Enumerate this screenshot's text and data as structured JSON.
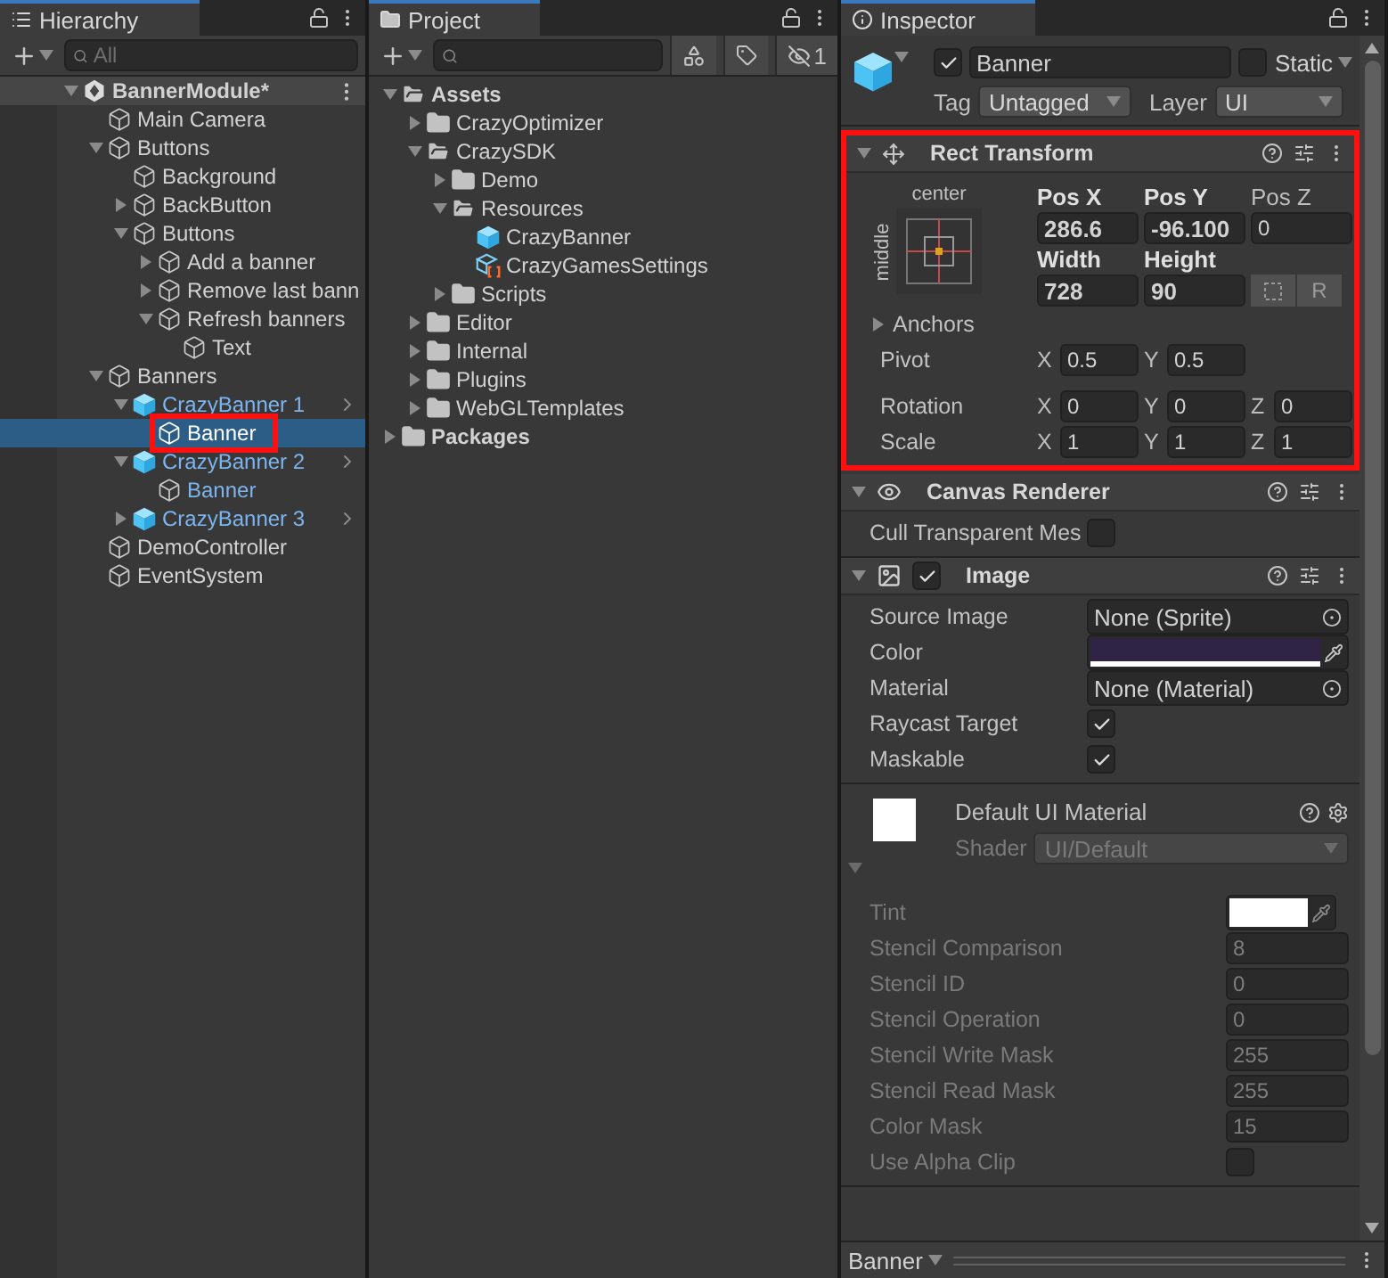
{
  "hierarchy": {
    "tab": "Hierarchy",
    "search": {
      "placeholder": "All"
    },
    "tree": [
      {
        "kind": "scene",
        "label": "BannerModule*",
        "expanded": true,
        "selected": false,
        "children": [
          {
            "kind": "object",
            "label": "Main Camera",
            "selected": false
          },
          {
            "kind": "object",
            "label": "Buttons",
            "expanded": true,
            "selected": false,
            "children": [
              {
                "kind": "object",
                "label": "Background",
                "selected": false
              },
              {
                "kind": "object",
                "label": "BackButton",
                "expanded": false,
                "selected": false
              },
              {
                "kind": "object",
                "label": "Buttons",
                "expanded": true,
                "selected": false,
                "children": [
                  {
                    "kind": "object",
                    "label": "Add a banner",
                    "expanded": false,
                    "selected": false
                  },
                  {
                    "kind": "object",
                    "label": "Remove last bann",
                    "expanded": false,
                    "selected": false
                  },
                  {
                    "kind": "object",
                    "label": "Refresh banners",
                    "expanded": true,
                    "selected": false,
                    "children": [
                      {
                        "kind": "object",
                        "label": "Text",
                        "selected": false
                      }
                    ]
                  }
                ]
              }
            ]
          },
          {
            "kind": "object",
            "label": "Banners",
            "expanded": true,
            "selected": false,
            "children": [
              {
                "kind": "prefab",
                "label": "CrazyBanner 1",
                "expanded": true,
                "selected": false,
                "children": [
                  {
                    "kind": "prefab_child",
                    "label": "Banner",
                    "selected": true,
                    "highlighted": true
                  }
                ]
              },
              {
                "kind": "prefab",
                "label": "CrazyBanner 2",
                "expanded": true,
                "selected": false,
                "children": [
                  {
                    "kind": "prefab_child",
                    "label": "Banner",
                    "selected": false
                  }
                ]
              },
              {
                "kind": "prefab",
                "label": "CrazyBanner 3",
                "expanded": false,
                "selected": false
              }
            ]
          },
          {
            "kind": "object",
            "label": "DemoController",
            "selected": false
          },
          {
            "kind": "object",
            "label": "EventSystem",
            "selected": false
          }
        ]
      }
    ]
  },
  "project": {
    "tab": "Project",
    "hidden_count": "1",
    "tree": [
      {
        "kind": "folder",
        "label": "Assets",
        "expanded": true,
        "selected": false,
        "children": [
          {
            "kind": "folder",
            "label": "CrazyOptimizer",
            "expanded": false,
            "selected": false
          },
          {
            "kind": "folder",
            "label": "CrazySDK",
            "expanded": true,
            "selected": false,
            "children": [
              {
                "kind": "folder",
                "label": "Demo",
                "expanded": false,
                "selected": false
              },
              {
                "kind": "folder",
                "label": "Resources",
                "expanded": true,
                "selected": false,
                "children": [
                  {
                    "kind": "prefab_asset",
                    "label": "CrazyBanner",
                    "selected": false
                  },
                  {
                    "kind": "settings_asset",
                    "label": "CrazyGamesSettings",
                    "selected": false
                  }
                ]
              },
              {
                "kind": "folder",
                "label": "Scripts",
                "expanded": false,
                "selected": false
              }
            ]
          },
          {
            "kind": "folder",
            "label": "Editor",
            "expanded": false,
            "selected": false
          },
          {
            "kind": "folder",
            "label": "Internal",
            "expanded": false,
            "selected": false
          },
          {
            "kind": "folder",
            "label": "Plugins",
            "expanded": false,
            "selected": false
          },
          {
            "kind": "folder",
            "label": "WebGLTemplates",
            "expanded": false,
            "selected": false
          }
        ]
      },
      {
        "kind": "folder",
        "label": "Packages",
        "expanded": false,
        "selected": false
      }
    ]
  },
  "inspector": {
    "tab": "Inspector",
    "object": {
      "active": true,
      "name": "Banner",
      "static": false,
      "static_label": "Static",
      "tag_label": "Tag",
      "tag": "Untagged",
      "layer_label": "Layer",
      "layer": "UI"
    },
    "components": [
      {
        "kind": "rect_transform",
        "title": "Rect Transform",
        "expanded": true,
        "highlighted": true,
        "anchor_h": "center",
        "anchor_v": "middle",
        "fields": [
          {
            "label": "Pos X",
            "value": "286.6",
            "overridden": true
          },
          {
            "label": "Pos Y",
            "value": "-96.100",
            "overridden": true
          },
          {
            "label": "Pos Z",
            "value": "0",
            "overridden": false
          },
          {
            "label": "Width",
            "value": "728",
            "overridden": true
          },
          {
            "label": "Height",
            "value": "90",
            "overridden": true
          }
        ],
        "raw_edit": "R",
        "anchors": {
          "label": "Anchors",
          "expanded": false
        },
        "vectors": [
          {
            "label": "Pivot",
            "axes": [
              {
                "axis": "X",
                "value": "0.5"
              },
              {
                "axis": "Y",
                "value": "0.5"
              }
            ]
          },
          {
            "label": "Rotation",
            "axes": [
              {
                "axis": "X",
                "value": "0"
              },
              {
                "axis": "Y",
                "value": "0"
              },
              {
                "axis": "Z",
                "value": "0"
              }
            ]
          },
          {
            "label": "Scale",
            "axes": [
              {
                "axis": "X",
                "value": "1"
              },
              {
                "axis": "Y",
                "value": "1"
              },
              {
                "axis": "Z",
                "value": "1"
              }
            ]
          }
        ]
      },
      {
        "kind": "canvas_renderer",
        "title": "Canvas Renderer",
        "expanded": true,
        "highlighted": false,
        "properties": [
          {
            "kind": "checkbox",
            "label": "Cull Transparent Mes",
            "checked": false
          }
        ]
      },
      {
        "kind": "image",
        "title": "Image",
        "expanded": true,
        "highlighted": false,
        "enabled": true,
        "properties": [
          {
            "kind": "object",
            "label": "Source Image",
            "value": "None (Sprite)"
          },
          {
            "kind": "color",
            "label": "Color",
            "color": "#2f2446"
          },
          {
            "kind": "object",
            "label": "Material",
            "value": "None (Material)"
          },
          {
            "kind": "checkbox",
            "label": "Raycast Target",
            "checked": true
          },
          {
            "kind": "checkbox",
            "label": "Maskable",
            "checked": true
          }
        ]
      },
      {
        "kind": "material",
        "title": "Default UI Material",
        "expanded": true,
        "highlighted": false,
        "shader_label": "Shader",
        "shader": "UI/Default",
        "properties": [
          {
            "kind": "color",
            "label": "Tint",
            "color": "#ffffff"
          },
          {
            "kind": "number",
            "label": "Stencil Comparison",
            "value": "8"
          },
          {
            "kind": "number",
            "label": "Stencil ID",
            "value": "0"
          },
          {
            "kind": "number",
            "label": "Stencil Operation",
            "value": "0"
          },
          {
            "kind": "number",
            "label": "Stencil Write Mask",
            "value": "255"
          },
          {
            "kind": "number",
            "label": "Stencil Read Mask",
            "value": "255"
          },
          {
            "kind": "number",
            "label": "Color Mask",
            "value": "15"
          },
          {
            "kind": "checkbox",
            "label": "Use Alpha Clip",
            "checked": false
          }
        ]
      }
    ],
    "footer": {
      "label": "Banner"
    }
  }
}
